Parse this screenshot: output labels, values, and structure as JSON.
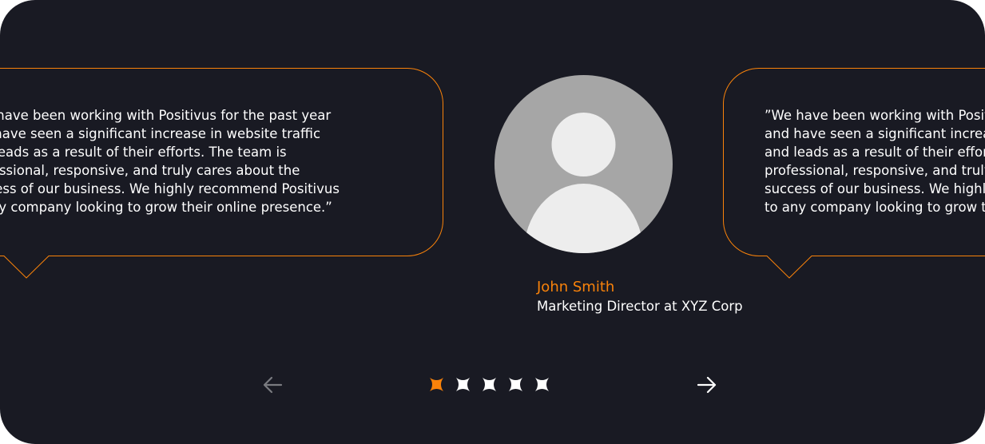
{
  "testimonials": [
    {
      "quote": "”We have been working with Positivus for the past year\nand have seen a significant increase in website traffic\nand leads as a result of their efforts. The team is\nprofessional, responsive, and truly cares about the\nsuccess of our business. We highly recommend Positivus\nto any company looking to grow their online presence.”"
    },
    {
      "quote": "”We have been working with Positivus for the past year\nand have seen a significant increase in website traffic\nand leads as a result of their efforts. The team is\nprofessional, responsive, and truly cares about the\nsuccess of our business. We highly recommend Positivus\nto any company looking to grow their online presence.”"
    }
  ],
  "author": {
    "name": "John Smith",
    "role": "Marketing Director at XYZ Corp",
    "avatar_icon": "user-placeholder-icon"
  },
  "navigation": {
    "prev_icon": "arrow-left-icon",
    "next_icon": "arrow-right-icon",
    "prev_enabled": false,
    "next_enabled": true,
    "dot_icon": "star-dot-icon",
    "dot_count": 5,
    "active_index": 0
  },
  "colors": {
    "background": "#191A23",
    "accent": "#F9820A",
    "text": "#FFFFFF",
    "arrow_disabled": "#7A7B80",
    "avatar_bg": "#A6A6A6",
    "avatar_fg": "#EDEDED"
  }
}
